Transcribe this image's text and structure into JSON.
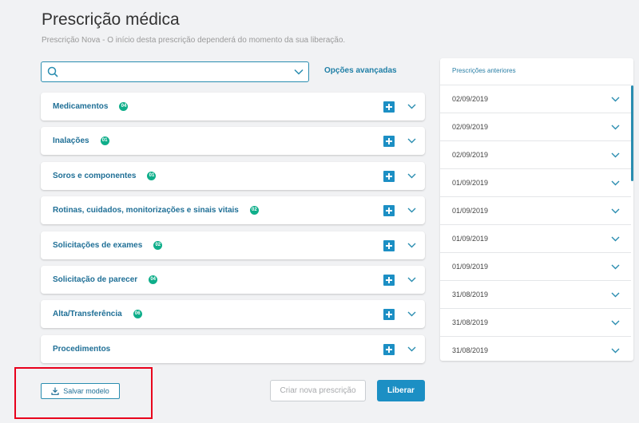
{
  "header": {
    "title": "Prescrição médica",
    "subtitle": "Prescrição Nova - O início desta prescrição dependerá do momento da sua liberação."
  },
  "search": {
    "value": "",
    "placeholder": ""
  },
  "advanced_link": "Opções avançadas",
  "sections": [
    {
      "label": "Medicamentos",
      "badge": "04"
    },
    {
      "label": "Inalações",
      "badge": "01"
    },
    {
      "label": "Soros e componentes",
      "badge": "01"
    },
    {
      "label": "Rotinas, cuidados, monitorizações e sinais vitais",
      "badge": "02"
    },
    {
      "label": "Solicitações de exames",
      "badge": "02"
    },
    {
      "label": "Solicitação de parecer",
      "badge": "04"
    },
    {
      "label": "Alta/Transferência",
      "badge": "06"
    },
    {
      "label": "Procedimentos",
      "badge": ""
    }
  ],
  "history": {
    "title": "Prescrições anteriores",
    "items": [
      "02/09/2019",
      "02/09/2019",
      "02/09/2019",
      "01/09/2019",
      "01/09/2019",
      "01/09/2019",
      "01/09/2019",
      "31/08/2019",
      "31/08/2019",
      "31/08/2019"
    ]
  },
  "actions": {
    "save_model": "Salvar modelo",
    "new_prescription": "Criar nova prescrição",
    "release": "Liberar"
  },
  "colors": {
    "accent": "#1c8fc4",
    "badge": "#0fae8a",
    "highlight": "#e8001c"
  },
  "icons": {
    "search": "search-icon",
    "chevron": "chevron-down-icon",
    "add": "plus-icon",
    "download": "download-icon"
  }
}
